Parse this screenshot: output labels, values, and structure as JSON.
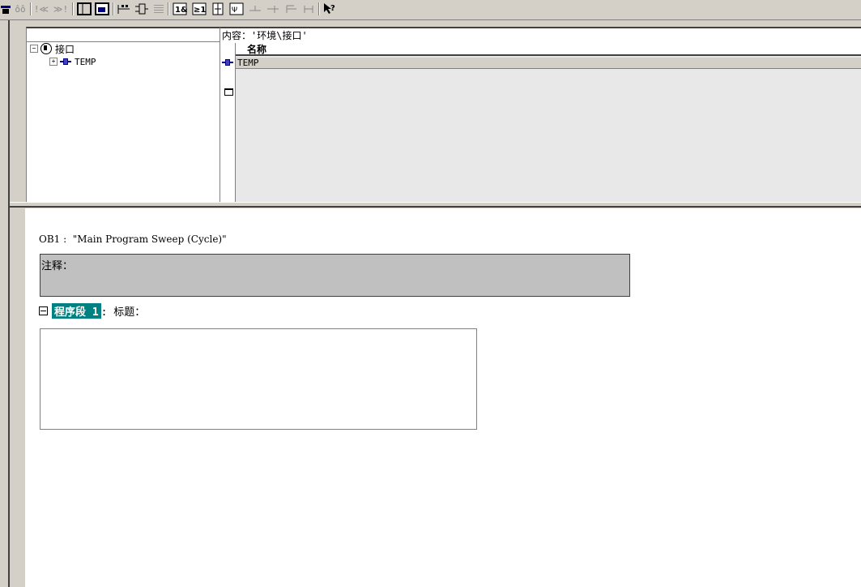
{
  "toolbar": {
    "buttons": [
      {
        "name": "network-icon"
      },
      {
        "name": "oo-icon",
        "label": "ôô"
      },
      {
        "name": "prev-icon",
        "label": "!≪"
      },
      {
        "name": "next-icon",
        "label": "≫!"
      },
      {
        "name": "window-icon"
      },
      {
        "name": "overview-icon"
      },
      {
        "name": "ladder-icon"
      },
      {
        "name": "fbd-icon"
      },
      {
        "name": "stl-icon"
      },
      {
        "name": "and-icon"
      },
      {
        "name": "or-icon"
      },
      {
        "name": "branch-icon"
      },
      {
        "name": "coil-icon"
      },
      {
        "name": "line-icon"
      },
      {
        "name": "open-branch-icon"
      },
      {
        "name": "close-branch-icon"
      },
      {
        "name": "help-icon"
      }
    ]
  },
  "tree": {
    "root_label": "接口",
    "child_label": "TEMP"
  },
  "detail": {
    "title": "内容：'环境\\接口'",
    "column_header": "名称",
    "rows": [
      "TEMP"
    ]
  },
  "code": {
    "block_title": "OB1 :  \"Main Program Sweep (Cycle)\"",
    "comment_label": "注释：",
    "network_label": "程序段 1",
    "network_title": ": 标题："
  },
  "colors": {
    "window_bg": "#d4d0c8",
    "network_highlight": "#008080",
    "comment_bg": "#c0c0c0"
  }
}
